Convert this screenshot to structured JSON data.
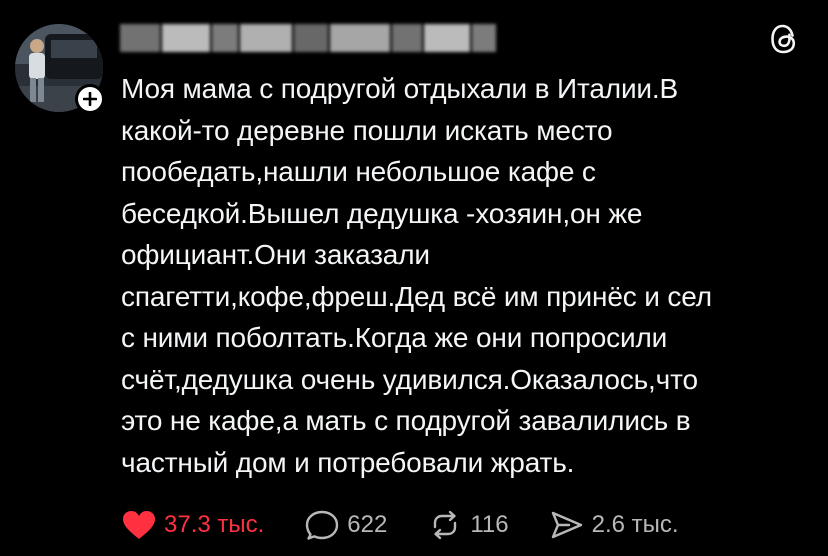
{
  "post": {
    "text": "Моя мама с подругой отдыхали в Италии.В\nкакой-то деревне пошли искать место\nпообедать,нашли небольшое кафе с\nбеседкой.Вышел дедушка -хозяин,он же\nофициант.Они заказали\nспагетти,кофе,фреш.Дед всё им принёс и сел\nс ними поболтать.Когда же они попросили\nсчёт,дедушка очень удивился.Оказалось,что\nэто не кафе,а мать с подругой завалились в\nчастный дом и потребовали жрать."
  },
  "actions": {
    "likes": "37.3 тыс.",
    "replies": "622",
    "reposts": "116",
    "shares": "2.6 тыс."
  },
  "colors": {
    "background": "#000000",
    "text": "#f3f5f7",
    "like_accent": "#ff3040",
    "muted": "#b8b8b8"
  },
  "icons": [
    "threads-logo-icon",
    "plus-icon",
    "heart-icon",
    "reply-bubble-icon",
    "repost-icon",
    "share-send-icon"
  ]
}
